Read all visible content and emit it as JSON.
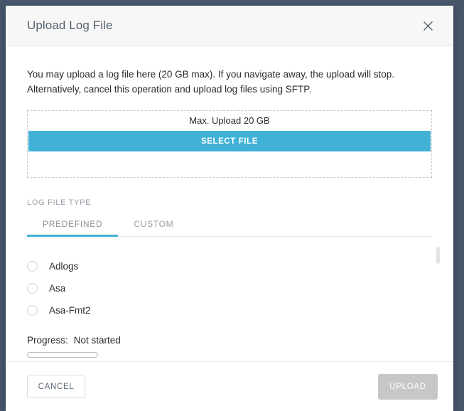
{
  "colors": {
    "backdrop": "#46566b",
    "accent": "#41b2d6",
    "header_bg": "#f7f7f8",
    "disabled_button": "#c6c7c9",
    "muted_text": "#9aa0a8"
  },
  "dialog": {
    "title": "Upload Log File",
    "close_icon": "close-icon",
    "intro_line1": "You may upload a log file here (20 GB max). If you navigate away, the upload will stop.",
    "intro_line2": "Alternatively, cancel this operation and upload log files using SFTP.",
    "dropzone": {
      "max_upload_label": "Max. Upload 20 GB",
      "select_file_label": "SELECT FILE"
    },
    "log_file_type": {
      "section_label": "LOG FILE TYPE",
      "tabs": [
        {
          "label": "PREDEFINED",
          "active": true
        },
        {
          "label": "CUSTOM",
          "active": false
        }
      ],
      "options": [
        {
          "label": "Adlogs",
          "selected": false
        },
        {
          "label": "Asa",
          "selected": false
        },
        {
          "label": "Asa-Fmt2",
          "selected": false
        }
      ]
    },
    "progress": {
      "label": "Progress:",
      "status": "Not started",
      "percent": 0
    },
    "footer": {
      "cancel_label": "CANCEL",
      "upload_label": "UPLOAD",
      "upload_disabled": true
    }
  }
}
